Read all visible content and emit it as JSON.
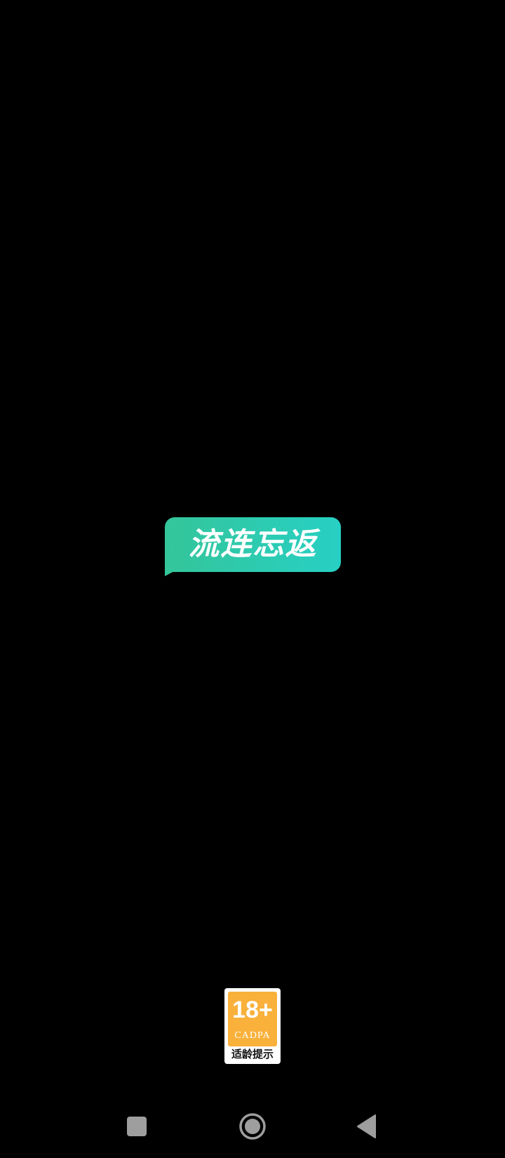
{
  "splash": {
    "app_name": "流连忘返",
    "brand_gradient": [
      "#34c59a",
      "#27d0c4"
    ],
    "background": "#000000"
  },
  "age_rating": {
    "age": "18+",
    "org": "CADPA",
    "caption": "适龄提示",
    "badge_color": "#f9b13b"
  },
  "navbar": {
    "buttons": [
      {
        "icon": "square-recents-icon"
      },
      {
        "icon": "circle-home-icon"
      },
      {
        "icon": "triangle-back-icon"
      }
    ],
    "icon_color": "#9e9e9e"
  }
}
